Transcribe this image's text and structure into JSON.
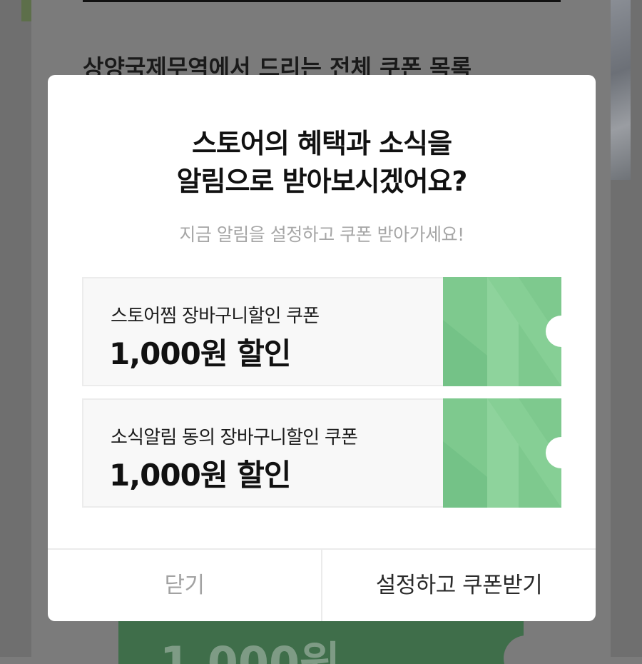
{
  "background": {
    "heading": "상양국제무역에서 드리는 전체 쿠폰 목록",
    "coupon_amount": "1,000원"
  },
  "modal": {
    "title_line1": "스토어의 혜택과 소식을",
    "title_line2": "알림으로 받아보시겠어요?",
    "subtitle": "지금 알림을 설정하고 쿠폰 받아가세요!",
    "coupons": [
      {
        "name": "스토어찜 장바구니할인 쿠폰",
        "amount": "1,000원 할인"
      },
      {
        "name": "소식알림 동의 장바구니할인 쿠폰",
        "amount": "1,000원 할인"
      }
    ],
    "close_label": "닫기",
    "confirm_label": "설정하고 쿠폰받기"
  },
  "colors": {
    "overlay": "#7b7b7b",
    "coupon_green": "#7ec98e",
    "coupon_green_light": "#93d6a1",
    "coupon_green_dark": "#6fbd82"
  },
  "icons": {
    "coupon_graphic": "naver-n-ticket-icon"
  }
}
